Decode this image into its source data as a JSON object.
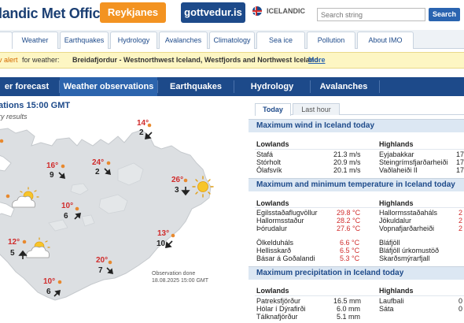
{
  "header": {
    "logo_text": "landic Met Office",
    "region_button": "Reykjanes",
    "site_button": "gottvedur.is",
    "language": "ICELANDIC",
    "search_placeholder": "Search string",
    "search_button": "Search"
  },
  "tabs": [
    "Weather",
    "Earthquakes",
    "Hydrology",
    "Avalanches",
    "Climatology",
    "Sea ice",
    "Pollution",
    "About IMO"
  ],
  "alert": {
    "prefix": "v alert",
    "text": "for weather:",
    "region": "Breidafjordur - Westnorthwest Iceland, Westfjords and Northwest Iceland",
    "more": "More"
  },
  "nav": [
    "er forecast",
    "Weather observations",
    "Earthquakes",
    "Hydrology",
    "Avalanches"
  ],
  "nav_active": "Weather observations",
  "map": {
    "title": "ations 15:00 GMT",
    "subtitle": "ry results",
    "observation_note_line1": "Observation done",
    "observation_note_line2": "18.08.2025 15:00 GMT",
    "stations": [
      {
        "temp": "14°",
        "wind": "2",
        "dir": "sw"
      },
      {
        "temp": "16°",
        "wind": "9",
        "dir": "se"
      },
      {
        "temp": "24°",
        "wind": "2",
        "dir": "se"
      },
      {
        "temp": "26°",
        "wind": "3",
        "dir": "s"
      },
      {
        "temp": "10°",
        "wind": "6",
        "dir": "ne"
      },
      {
        "temp": "13°",
        "wind": "10",
        "dir": "sw"
      },
      {
        "temp": "12°",
        "wind": "5",
        "dir": "n"
      },
      {
        "temp": "20°",
        "wind": "7",
        "dir": "se"
      },
      {
        "temp": "10°",
        "wind": "6",
        "dir": "ne"
      }
    ]
  },
  "panel": {
    "tab_today": "Today",
    "tab_last_hour": "Last hour",
    "wind": {
      "title": "Maximum wind in Iceland today",
      "low_label": "Lowlands",
      "high_label": "Highlands",
      "lowlands": [
        {
          "name": "Stafá",
          "value": "21.3 m/s"
        },
        {
          "name": "Stórholt",
          "value": "20.9 m/s"
        },
        {
          "name": "Ólafsvík",
          "value": "20.1 m/s"
        }
      ],
      "highlands": [
        {
          "name": "Eyjabakkar",
          "value": "17"
        },
        {
          "name": "Steingrímsfjarðarheiði",
          "value": "17"
        },
        {
          "name": "Vaðlaheiði II",
          "value": "17"
        }
      ]
    },
    "temp": {
      "title": "Maximum and minimum temperature in Iceland today",
      "low_label": "Lowlands",
      "high_label": "Highlands",
      "lowlands_max": [
        {
          "name": "Egilsstaðaflugvöllur",
          "value": "29.8 °C"
        },
        {
          "name": "Hallormsstaður",
          "value": "28.2 °C"
        },
        {
          "name": "Þórudalur",
          "value": "27.6 °C"
        }
      ],
      "highlands_max": [
        {
          "name": "Hallormsstaðaháls",
          "value": "2"
        },
        {
          "name": "Jökuldalur",
          "value": "2"
        },
        {
          "name": "Vopnafjarðarheiði",
          "value": "2"
        }
      ],
      "lowlands_min": [
        {
          "name": "Ölkelduháls",
          "value": "6.6 °C"
        },
        {
          "name": "Hellisskarð",
          "value": "6.5 °C"
        },
        {
          "name": "Básar á Goðalandi",
          "value": "5.3 °C"
        }
      ],
      "highlands_min": [
        {
          "name": "Bláfjöll",
          "value": ""
        },
        {
          "name": "Bláfjöll úrkomustöð",
          "value": ""
        },
        {
          "name": "Skarðsmýrarfjall",
          "value": ""
        }
      ]
    },
    "precip": {
      "title": "Maximum precipitation in Iceland today",
      "low_label": "Lowlands",
      "high_label": "Highlands",
      "lowlands": [
        {
          "name": "Patreksfjörður",
          "value": "16.5 mm"
        },
        {
          "name": "Hólar í Dýrafirði",
          "value": "6.0 mm"
        },
        {
          "name": "Tálknafjörður",
          "value": "5.1 mm"
        }
      ],
      "highlands": [
        {
          "name": "Laufbali",
          "value": "0"
        },
        {
          "name": "Sáta",
          "value": "0"
        }
      ]
    }
  },
  "colors": {
    "navy": "#1d4a8a",
    "orange": "#f39321",
    "temp_red": "#d02c2c",
    "alert_bg": "#fdf6c3",
    "section_bg": "#dce7f3"
  }
}
